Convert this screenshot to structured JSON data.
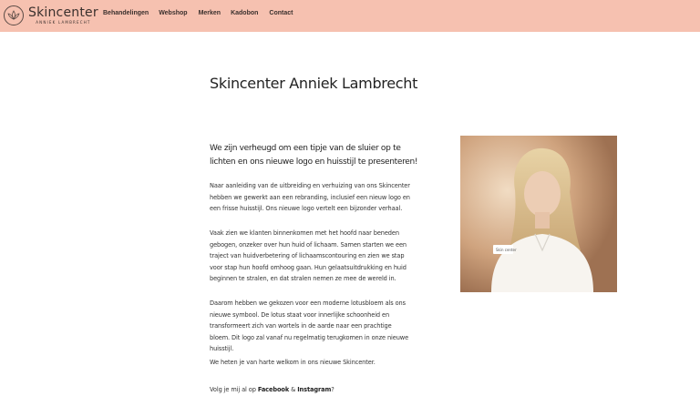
{
  "header": {
    "logo": {
      "title": "Skincenter",
      "subtitle": "ANNIEK LAMBRECHT"
    },
    "nav": [
      {
        "label": "Behandelingen"
      },
      {
        "label": "Webshop"
      },
      {
        "label": "Merken"
      },
      {
        "label": "Kadobon"
      },
      {
        "label": "Contact"
      }
    ],
    "colors": {
      "background": "#f6c1b0",
      "text": "#3a302d"
    }
  },
  "main": {
    "title": "Skincenter Anniek Lambrecht",
    "intro": "We zijn verheugd om een tipje van de sluier op te lichten en ons nieuwe logo en huisstijl te presenteren!",
    "paragraphs": [
      "Naar aanleiding van de uitbreiding en verhuizing van ons Skincenter hebben we gewerkt aan een rebranding, inclusief een nieuw logo en een frisse huisstijl. Ons nieuwe logo vertelt een bijzonder verhaal.",
      "Vaak zien we klanten binnenkomen met het hoofd naar beneden gebogen, onzeker over hun huid of lichaam. Samen starten we een traject van huidverbetering of lichaamscontouring en zien we stap voor stap hun hoofd omhoog gaan. Hun gelaatsuitdrukking en huid beginnen te stralen, en dat stralen nemen ze mee de wereld in.",
      "Daarom hebben we gekozen voor een moderne lotusbloem als ons nieuwe symbool. De lotus staat voor innerlijke schoonheid en transformeert zich van wortels in de aarde naar een prachtige bloem. Dit logo zal vanaf nu regelmatig terugkomen in onze nieuwe huisstijl.",
      "We heten je van harte welkom in ons nieuwe Skincenter."
    ],
    "follow": {
      "prefix": "Volg je mij al op ",
      "facebook": "Facebook",
      "and": " & ",
      "instagram": "Instagram",
      "suffix": "?"
    },
    "photo": {
      "icon": "portrait-photo",
      "badge_text": "Skin center"
    }
  }
}
